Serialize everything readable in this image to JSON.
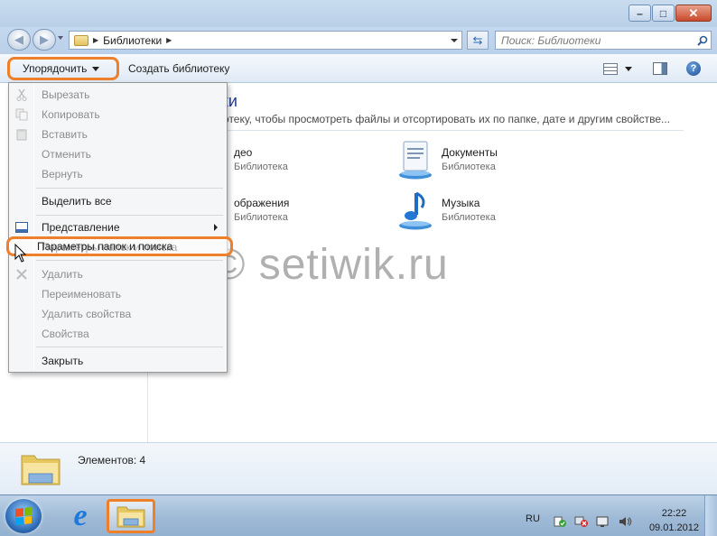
{
  "window": {
    "minimize_icon": "minimize-icon",
    "maximize_icon": "maximize-icon",
    "close_icon": "close-icon"
  },
  "address": {
    "breadcrumb": "Библиотеки",
    "search_placeholder": "Поиск: Библиотеки"
  },
  "toolbar": {
    "organize_label": "Упорядочить",
    "create_library_label": "Создать библиотеку"
  },
  "content": {
    "title": "теки",
    "description": "блиотеку, чтобы просмотреть файлы и отсортировать их по папке, дате и другим свойстве...",
    "libraries": [
      {
        "name": "део",
        "type": "Библиотека",
        "icon": "video-library-icon"
      },
      {
        "name": "Документы",
        "type": "Библиотека",
        "icon": "documents-library-icon"
      },
      {
        "name": "ображения",
        "type": "Библиотека",
        "icon": "pictures-library-icon"
      },
      {
        "name": "Музыка",
        "type": "Библиотека",
        "icon": "music-library-icon"
      }
    ]
  },
  "menu": {
    "items": [
      {
        "label": "Вырезать",
        "enabled": false,
        "icon": "cut-icon"
      },
      {
        "label": "Копировать",
        "enabled": false,
        "icon": "copy-icon"
      },
      {
        "label": "Вставить",
        "enabled": false,
        "icon": "paste-icon"
      },
      {
        "label": "Отменить",
        "enabled": false
      },
      {
        "label": "Вернуть",
        "enabled": false
      },
      {
        "label": "Выделить все",
        "enabled": true
      },
      {
        "label": "Представление",
        "enabled": true,
        "icon": "layout-icon",
        "submenu": true
      },
      {
        "label": "Параметры папок и поиска",
        "enabled": true,
        "highlighted": true
      },
      {
        "label": "Удалить",
        "enabled": false,
        "icon": "delete-icon"
      },
      {
        "label": "Переименовать",
        "enabled": false
      },
      {
        "label": "Удалить свойства",
        "enabled": false
      },
      {
        "label": "Свойства",
        "enabled": false
      },
      {
        "label": "Закрыть",
        "enabled": true
      }
    ]
  },
  "watermark": "© setiwik.ru",
  "details": {
    "count_text": "Элементов: 4"
  },
  "taskbar": {
    "language": "RU",
    "time": "22:22",
    "date": "09.01.2012"
  },
  "colors": {
    "highlight_outline": "#ee7f2b",
    "title_blue": "#1e3a8a"
  }
}
